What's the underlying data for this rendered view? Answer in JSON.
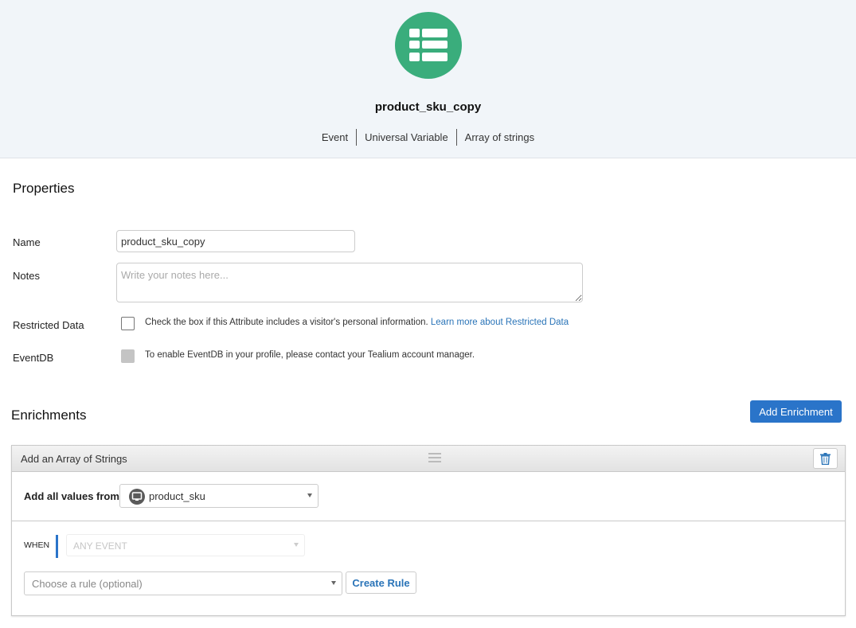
{
  "header": {
    "icon": "table-icon",
    "icon_color": "#3aad7c",
    "attribute_name": "product_sku_copy",
    "meta": [
      "Event",
      "Universal Variable",
      "Array of strings"
    ]
  },
  "properties": {
    "title": "Properties",
    "name_label": "Name",
    "name_value": "product_sku_copy",
    "notes_label": "Notes",
    "notes_placeholder": "Write your notes here...",
    "restricted_label": "Restricted Data",
    "restricted_help": "Check the box if this Attribute includes a visitor's personal information.",
    "restricted_link": "Learn more about Restricted Data",
    "restricted_checked": false,
    "eventdb_label": "EventDB",
    "eventdb_help": "To enable EventDB in your profile, please contact your Tealium account manager.",
    "eventdb_disabled": true
  },
  "enrichments": {
    "title": "Enrichments",
    "add_button": "Add Enrichment",
    "accent_color": "#2a74c9",
    "items": [
      {
        "title": "Add an Array of Strings",
        "source_label": "Add all values from",
        "source_icon": "monitor-icon",
        "source_value": "product_sku",
        "when_label": "WHEN",
        "when_value": "ANY EVENT",
        "rule_placeholder": "Choose a rule (optional)",
        "create_rule_button": "Create Rule"
      }
    ]
  }
}
